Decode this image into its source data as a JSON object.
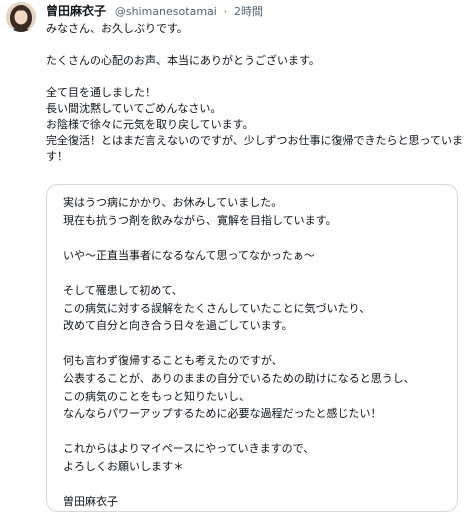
{
  "tweet": {
    "author_name": "曾田麻衣子",
    "handle": "@shimanesotamai",
    "separator": "·",
    "time": "2時間",
    "body": "みなさん、お久しぶりです。\n\nたくさんの心配のお声、本当にありがとうございます。\n\n全て目を通しました！\n長い間沈黙していてごめんなさい。\nお陰様で徐々に元気を取り戻しています。\n完全復活！とはまだ言えないのですが、少しずつお仕事に復帰できたらと思っています！",
    "attached_text": "実はうつ病にかかり、お休みしていました。\n現在も抗うつ剤を飲みながら、寛解を目指しています。\n\nいや〜正直当事者になるなんて思ってなかったぁ〜\n\nそして罹患して初めて、\nこの病気に対する誤解をたくさんしていたことに気づいたり、\n改めて自分と向き合う日々を過ごしています。\n\n何も言わず復帰することも考えたのですが、\n公表することが、ありのままの自分でいるための助けになると思うし、\nこの病気のことをもっと知りたいし、\nなんならパワーアップするために必要な過程だったと感じたい！\n\nこれからはよりマイペースにやっていきますので、\nよろしくお願いします＊\n\n曽田麻衣子"
  },
  "colors": {
    "text": "#0f1419",
    "muted": "#536471",
    "border": "#cfd9de"
  },
  "icons": {
    "avatar": "profile-photo"
  }
}
